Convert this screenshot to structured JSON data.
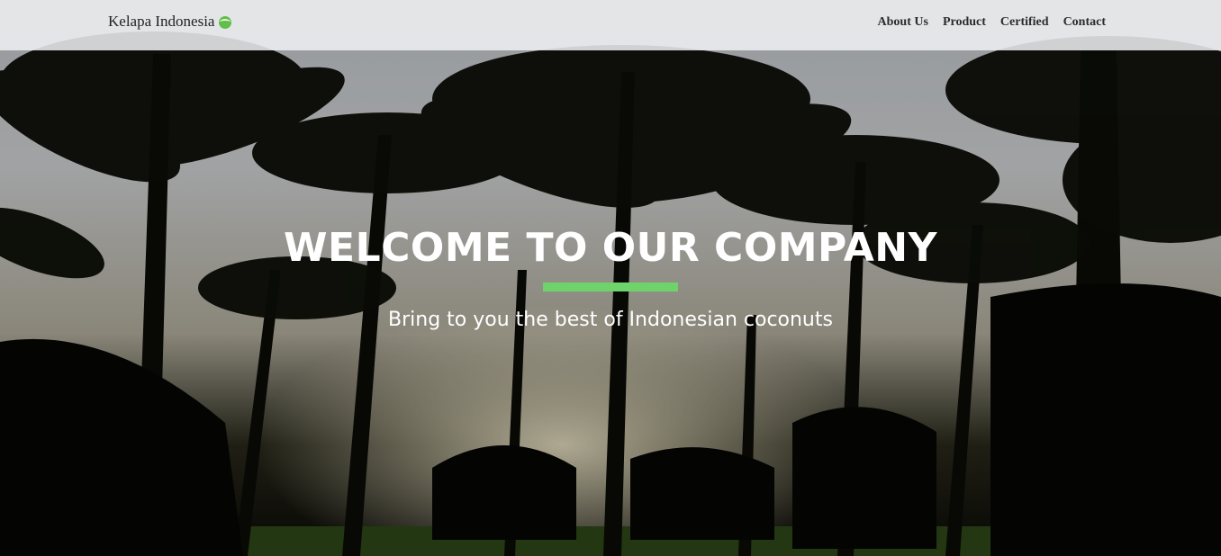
{
  "navbar": {
    "brand": "Kelapa Indonesia",
    "brand_icon": "coconut-icon",
    "links": [
      {
        "label": "About Us"
      },
      {
        "label": "Product"
      },
      {
        "label": "Certified"
      },
      {
        "label": "Contact"
      }
    ]
  },
  "hero": {
    "title": "WELCOME TO OUR COMPANY",
    "subtitle": "Bring to you the best of Indonesian coconuts",
    "accent_color": "#6ed36a",
    "background": "palm-trees-sunset-photo"
  }
}
